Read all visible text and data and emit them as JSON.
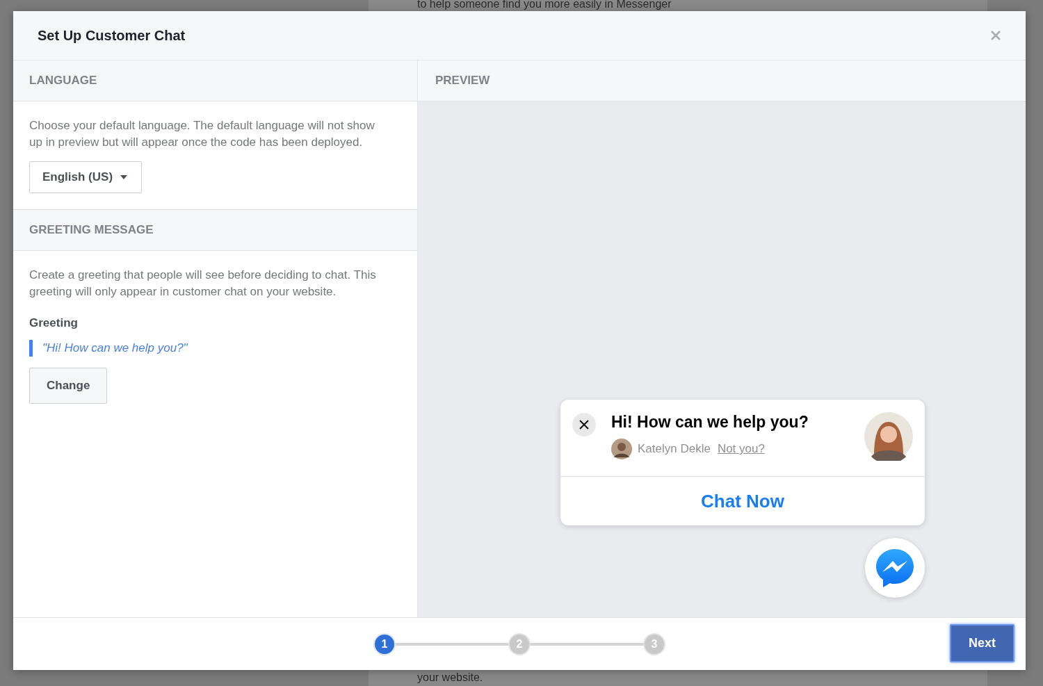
{
  "background_page": {
    "texts": [
      "to help someone find you more easily in Messenger",
      "your website."
    ]
  },
  "dialog": {
    "title": "Set Up Customer Chat"
  },
  "language_section": {
    "heading": "LANGUAGE",
    "description": "Choose your default language. The default language will not show up in preview but will appear once the code has been deployed.",
    "dropdown": {
      "value": "English (US)"
    }
  },
  "greeting_section": {
    "heading": "GREETING MESSAGE",
    "description": "Create a greeting that people will see before deciding to chat. This greeting will only appear in customer chat on your website.",
    "label": "Greeting",
    "greeting": "\"Hi! How can we help you?\"",
    "button": "Change"
  },
  "preview": {
    "heading": "PREVIEW",
    "chat_card": {
      "greeting": "Hi! How can we help you?",
      "user_name": "Katelyn Dekle",
      "switch_link": "Not you?",
      "action": "Chat Now"
    }
  },
  "steps": [
    {
      "label": "1",
      "selected": true
    },
    {
      "label": "2",
      "selected": false
    },
    {
      "label": "3",
      "selected": false
    }
  ],
  "next_button": "Next"
}
